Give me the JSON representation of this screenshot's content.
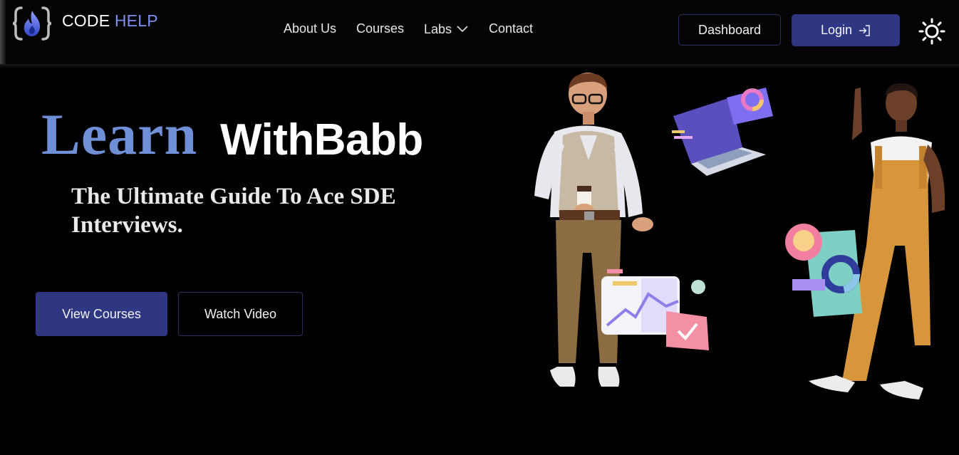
{
  "header": {
    "logo": {
      "code": "CODE",
      "help": "HELP",
      "icon": "flame-braces-logo"
    },
    "nav": [
      {
        "label": "About Us"
      },
      {
        "label": "Courses"
      },
      {
        "label": "Labs",
        "icon": "chevron-down-icon"
      },
      {
        "label": "Contact"
      }
    ],
    "dashboard_label": "Dashboard",
    "login_label": "Login",
    "login_icon": "login-arrow-icon",
    "theme_icon": "sun-icon"
  },
  "hero": {
    "title_accent": "Learn",
    "title_main": "WithBabb",
    "subtitle": "The Ultimate Guide To Ace SDE Interviews.",
    "primary_cta": "View Courses",
    "secondary_cta": "Watch Video"
  },
  "colors": {
    "accent": "#2f3682",
    "logo_help": "#7e8ff0",
    "title_accent": "#6f8fd6",
    "background": "#000000"
  }
}
